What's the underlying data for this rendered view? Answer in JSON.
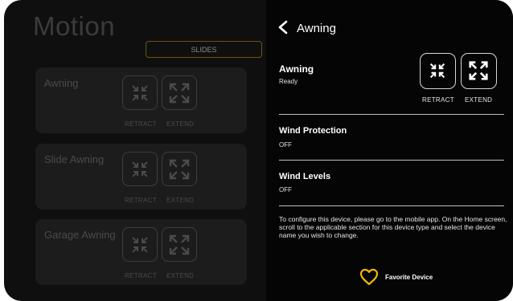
{
  "background": {
    "title": "Motion",
    "tab_label": "SLIDES",
    "cards": [
      {
        "name": "Awning",
        "retract_label": "RETRACT",
        "extend_label": "EXTEND"
      },
      {
        "name": "Slide Awning",
        "retract_label": "RETRACT",
        "extend_label": "EXTEND"
      },
      {
        "name": "Garage Awning",
        "retract_label": "RETRACT",
        "extend_label": "EXTEND"
      }
    ]
  },
  "panel": {
    "title": "Awning",
    "device": {
      "name": "Awning",
      "status": "Ready",
      "retract_label": "RETRACT",
      "extend_label": "EXTEND"
    },
    "sections": [
      {
        "title": "Wind Protection",
        "value": "OFF"
      },
      {
        "title": "Wind Levels",
        "value": "OFF"
      }
    ],
    "info_text": "To configure this device, please go to the mobile app. On the Home screen, scroll to the applicable section for this device type and select the device name you wish to change.",
    "favorite_label": "Favorite Device"
  },
  "colors": {
    "accent": "#f2b705",
    "panel_bg": "#050505",
    "screen_bg": "#0f0f0f"
  },
  "icons": [
    "back-chevron-icon",
    "retract-arrows-icon",
    "extend-arrows-icon",
    "heart-icon"
  ]
}
